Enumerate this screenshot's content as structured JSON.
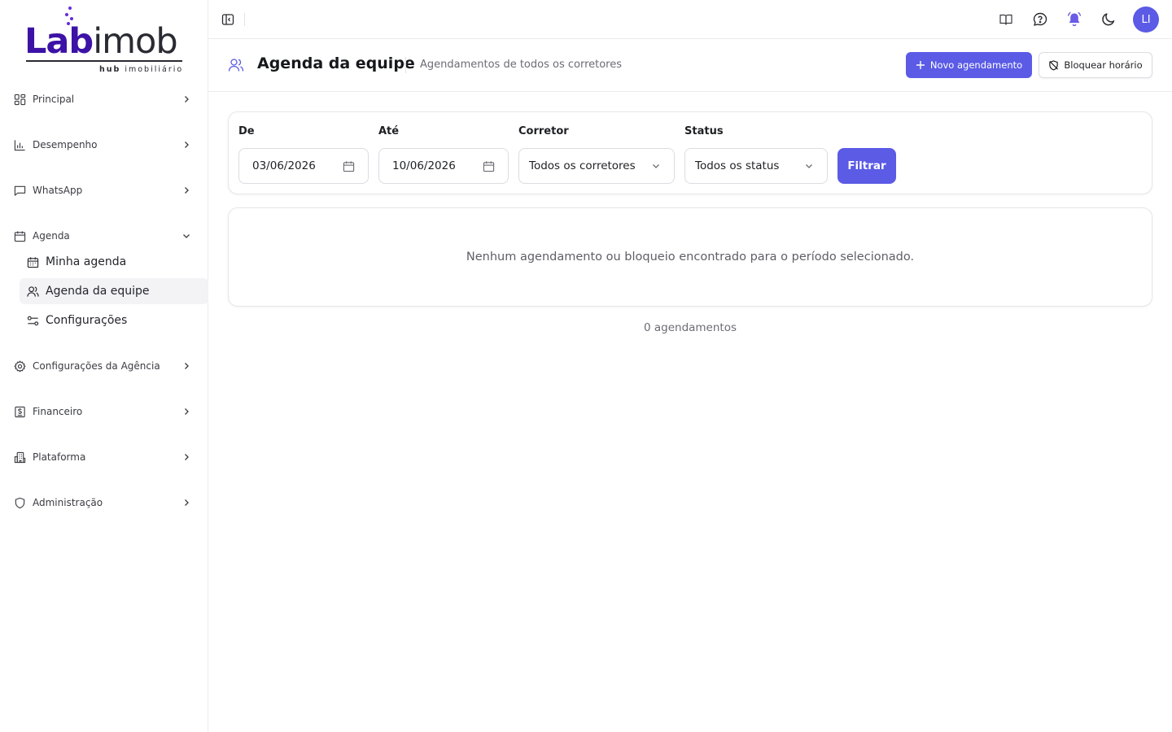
{
  "brand": {
    "word_part1": "Lab",
    "word_part2": "imob",
    "tagline_bold": "hub",
    "tagline_rest": " imobiliário",
    "primary_color": "#3d12a6",
    "accent_color": "#5b5be6"
  },
  "sidebar": {
    "items": [
      {
        "label": "Principal",
        "icon": "grid-icon"
      },
      {
        "label": "Desempenho",
        "icon": "bar-chart-icon"
      },
      {
        "label": "WhatsApp",
        "icon": "message-icon"
      },
      {
        "label": "Agenda",
        "icon": "calendar-icon"
      },
      {
        "label": "Configurações da Agência",
        "icon": "gear-icon"
      },
      {
        "label": "Financeiro",
        "icon": "receipt-icon"
      },
      {
        "label": "Plataforma",
        "icon": "building-icon"
      },
      {
        "label": "Administração",
        "icon": "shield-icon"
      }
    ],
    "agenda_sub": [
      {
        "label": "Minha agenda",
        "icon": "calendar-icon"
      },
      {
        "label": "Agenda da equipe",
        "icon": "users-icon"
      },
      {
        "label": "Configurações",
        "icon": "sliders-icon"
      }
    ]
  },
  "topbar": {
    "avatar_initials": "LI"
  },
  "header": {
    "title": "Agenda da equipe",
    "subtitle": "Agendamentos de todos os corretores",
    "new_button": "Novo agendamento",
    "block_button": "Bloquear horário"
  },
  "filters": {
    "from_label": "De",
    "from_value": "03/06/2026",
    "to_label": "Até",
    "to_value": "10/06/2026",
    "broker_label": "Corretor",
    "broker_value": "Todos os corretores",
    "status_label": "Status",
    "status_value": "Todos os status",
    "filter_button": "Filtrar"
  },
  "results": {
    "empty_message": "Nenhum agendamento ou bloqueio encontrado para o período selecionado.",
    "count_text": "0 agendamentos"
  }
}
